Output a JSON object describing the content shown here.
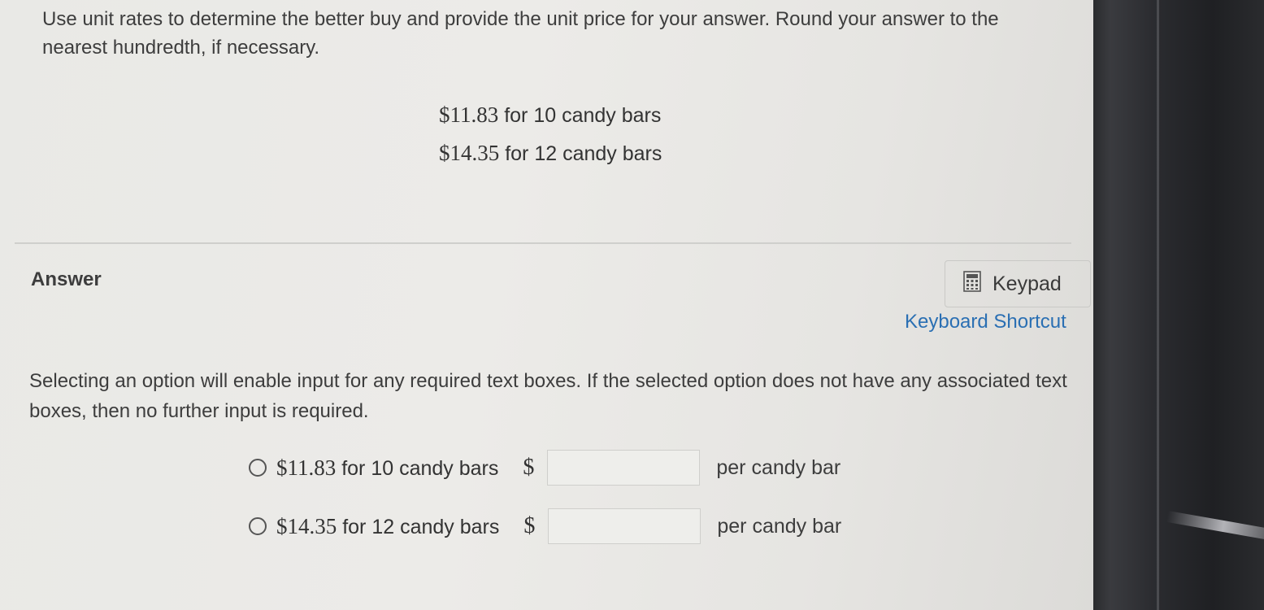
{
  "question": {
    "text": "Use unit rates to determine the better buy and provide the unit price for your answer. Round your answer to the nearest hundredth, if necessary."
  },
  "prices": [
    {
      "amount": "$11.83",
      "rest": "for 10 candy bars"
    },
    {
      "amount": "$14.35",
      "rest": "for 12 candy bars"
    }
  ],
  "answer": {
    "label": "Answer",
    "keypad_label": "Keypad",
    "keypad_icon": "calculator-icon",
    "shortcuts_label": "Keyboard Shortcut",
    "instructions": "Selecting an option will enable input for any required text boxes. If the selected option does not have any associated text boxes, then no further input is required."
  },
  "options": [
    {
      "amount": "$11.83",
      "rest": "for 10 candy bars",
      "currency": "$",
      "value": "",
      "unit": "per candy bar"
    },
    {
      "amount": "$14.35",
      "rest": "for 12 candy bars",
      "currency": "$",
      "value": "",
      "unit": "per candy bar"
    }
  ]
}
